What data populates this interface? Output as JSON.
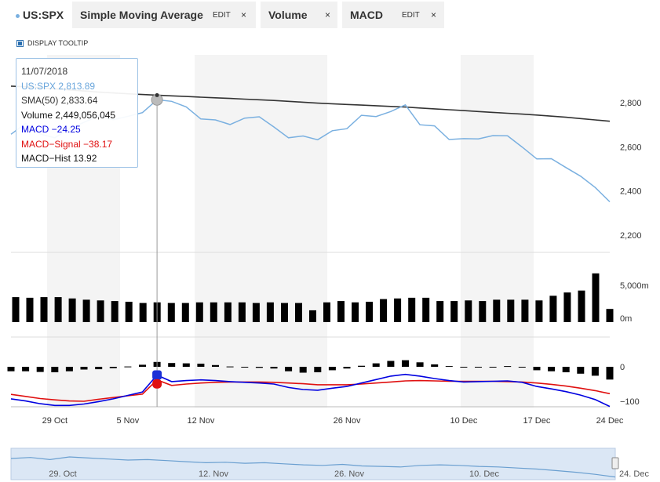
{
  "tabs": {
    "symbol": "US:SPX",
    "sma": {
      "label": "Simple Moving Average",
      "edit": "EDIT",
      "close": "×"
    },
    "volume": {
      "label": "Volume",
      "close": "×"
    },
    "macd": {
      "label": "MACD",
      "edit": "EDIT",
      "close": "×"
    }
  },
  "display_tooltip": "DISPLAY TOOLTIP",
  "tooltip": {
    "date": "11/07/2018",
    "symbol_line": "US:SPX   2,813.89",
    "sma_line": "SMA(50)   2,833.64",
    "volume_line": "Volume   2,449,056,045",
    "macd_line": "MACD   −24.25",
    "signal_line": "MACD−Signal   −38.17",
    "hist_line": "MACD−Hist   13.92"
  },
  "colors": {
    "price": "#7ab0e0",
    "sma": "#333333",
    "volume": "#000000",
    "macd": "#0000e0",
    "signal": "#e01010",
    "hist": "#000000",
    "band": "#f4f4f4",
    "navigator_fill": "#dbe7f5"
  },
  "chart_data": [
    {
      "type": "line",
      "title": "US:SPX",
      "dates": [
        "2018-10-24",
        "2018-10-25",
        "2018-10-26",
        "2018-10-29",
        "2018-10-30",
        "2018-10-31",
        "2018-11-01",
        "2018-11-02",
        "2018-11-05",
        "2018-11-06",
        "2018-11-07",
        "2018-11-08",
        "2018-11-09",
        "2018-11-12",
        "2018-11-13",
        "2018-11-14",
        "2018-11-15",
        "2018-11-16",
        "2018-11-19",
        "2018-11-20",
        "2018-11-21",
        "2018-11-23",
        "2018-11-26",
        "2018-11-27",
        "2018-11-28",
        "2018-11-29",
        "2018-11-30",
        "2018-12-03",
        "2018-12-04",
        "2018-12-06",
        "2018-12-07",
        "2018-12-10",
        "2018-12-11",
        "2018-12-12",
        "2018-12-13",
        "2018-12-14",
        "2018-12-17",
        "2018-12-18",
        "2018-12-19",
        "2018-12-20",
        "2018-12-21",
        "2018-12-24"
      ],
      "series": [
        {
          "name": "US:SPX",
          "values": [
            2657,
            2706,
            2658,
            2641,
            2682,
            2711,
            2740,
            2723,
            2738,
            2755,
            2813,
            2806,
            2781,
            2726,
            2722,
            2701,
            2730,
            2736,
            2690,
            2641,
            2649,
            2632,
            2673,
            2682,
            2743,
            2737,
            2760,
            2790,
            2700,
            2695,
            2633,
            2637,
            2636,
            2651,
            2650,
            2599,
            2545,
            2546,
            2506,
            2467,
            2416,
            2351
          ]
        },
        {
          "name": "SMA(50)",
          "values": [
            2875,
            2872,
            2868,
            2863,
            2858,
            2853,
            2848,
            2844,
            2840,
            2837,
            2834,
            2831,
            2828,
            2825,
            2822,
            2819,
            2816,
            2813,
            2810,
            2806,
            2802,
            2798,
            2795,
            2792,
            2789,
            2786,
            2783,
            2780,
            2776,
            2772,
            2768,
            2764,
            2760,
            2756,
            2752,
            2748,
            2744,
            2739,
            2734,
            2728,
            2722,
            2716
          ]
        }
      ],
      "ylim": [
        2200,
        2900
      ],
      "yticks": [
        "2,200",
        "2,400",
        "2,600",
        "2,800"
      ],
      "shaded_weeks": [
        "29 Oct",
        "12 Nov",
        "26 Nov",
        "10 Dec",
        "24 Dec"
      ]
    },
    {
      "type": "bar",
      "title": "Volume",
      "unit": "m",
      "values": [
        3800,
        3700,
        3800,
        3800,
        3600,
        3400,
        3300,
        3200,
        3100,
        2900,
        3000,
        2900,
        2900,
        3000,
        3000,
        3000,
        3000,
        2900,
        3000,
        2900,
        2900,
        1800,
        3000,
        3200,
        3000,
        3100,
        3500,
        3600,
        3700,
        3700,
        3200,
        3200,
        3300,
        3200,
        3400,
        3400,
        3400,
        3300,
        4000,
        4500,
        4800,
        7400,
        2000
      ],
      "ylim": [
        0,
        8000
      ],
      "yticks": [
        "0m",
        "5,000m"
      ]
    },
    {
      "type": "line",
      "title": "MACD",
      "series": [
        {
          "name": "MACD",
          "values": [
            -93,
            -99,
            -107,
            -112,
            -112,
            -108,
            -101,
            -93,
            -83,
            -73,
            -24,
            -43,
            -40,
            -38,
            -40,
            -43,
            -45,
            -47,
            -50,
            -60,
            -66,
            -68,
            -62,
            -57,
            -47,
            -37,
            -27,
            -22,
            -27,
            -34,
            -40,
            -44,
            -43,
            -42,
            -41,
            -45,
            -57,
            -64,
            -72,
            -82,
            -95,
            -115
          ]
        },
        {
          "name": "MACD-Signal",
          "values": [
            -80,
            -86,
            -92,
            -96,
            -99,
            -100,
            -94,
            -89,
            -84,
            -79,
            -38,
            -54,
            -50,
            -47,
            -45,
            -44,
            -44,
            -44,
            -45,
            -47,
            -49,
            -52,
            -52,
            -52,
            -50,
            -47,
            -44,
            -41,
            -40,
            -41,
            -42,
            -42,
            -42,
            -42,
            -43,
            -44,
            -47,
            -51,
            -56,
            -62,
            -69,
            -78
          ]
        },
        {
          "name": "MACD-Hist",
          "values": [
            -13,
            -13,
            -15,
            -16,
            -13,
            -8,
            -7,
            -4,
            1,
            6,
            14,
            11,
            10,
            9,
            5,
            1,
            -1,
            -3,
            -5,
            -13,
            -17,
            -16,
            -10,
            -5,
            3,
            10,
            17,
            19,
            13,
            7,
            2,
            -2,
            -1,
            0,
            2,
            -1,
            -10,
            -13,
            -16,
            -20,
            -26,
            -37
          ]
        }
      ],
      "ylim": [
        -120,
        15
      ],
      "yticks": [
        "−100",
        "0"
      ]
    }
  ],
  "x_axis": {
    "labels": [
      "29 Oct",
      "5 Nov",
      "12 Nov",
      "26 Nov",
      "10 Dec",
      "17 Dec",
      "24 Dec"
    ]
  },
  "navigator": {
    "labels": [
      "29. Oct",
      "12. Nov",
      "26. Nov",
      "10. Dec",
      "24. Dec"
    ]
  }
}
